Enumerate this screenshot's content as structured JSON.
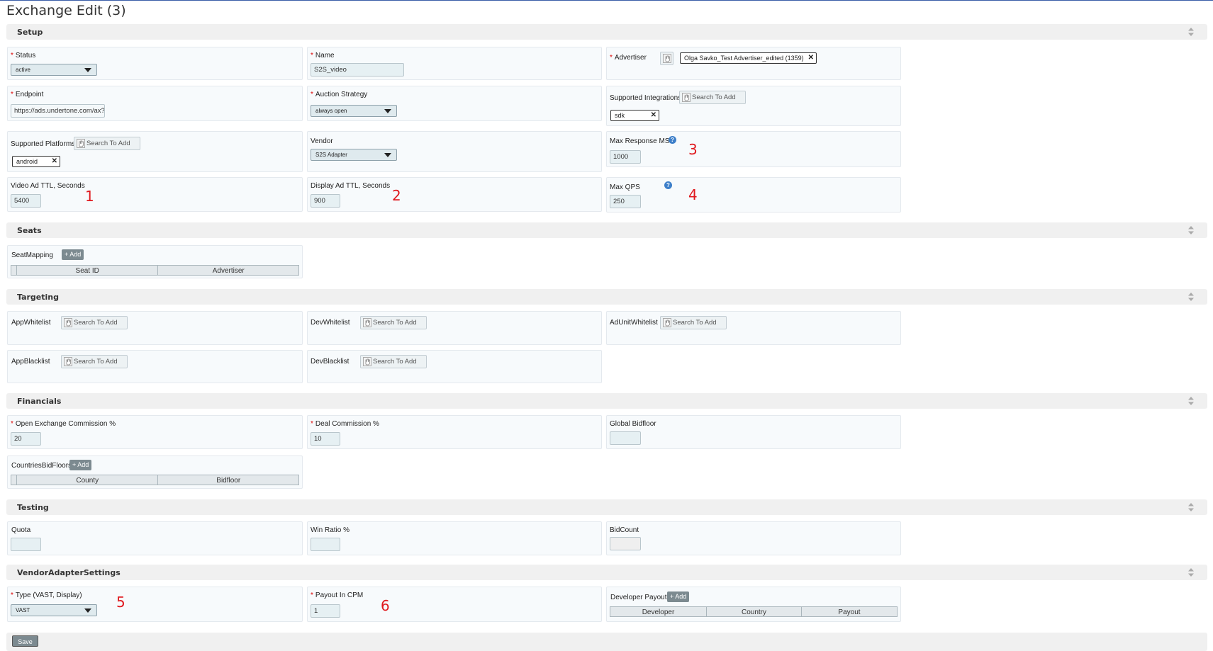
{
  "page": {
    "title": "Exchange Edit (3)"
  },
  "sections": {
    "setup": "Setup",
    "seats": "Seats",
    "targeting": "Targeting",
    "financials": "Financials",
    "testing": "Testing",
    "vendor": "VendorAdapterSettings"
  },
  "setup": {
    "status": {
      "label": "Status",
      "value": "active"
    },
    "name": {
      "label": "Name",
      "value": "S2S_video"
    },
    "advertiser": {
      "label": "Advertiser",
      "tag": "Olga Savko_Test Advertiser_edited (1359)"
    },
    "endpoint": {
      "label": "Endpoint",
      "value": "https://ads.undertone.com/ax?zo"
    },
    "auction_strategy": {
      "label": "Auction Strategy",
      "value": "always open"
    },
    "supported_integrations": {
      "label": "Supported Integrations",
      "placeholder": "Search To Add",
      "tag": "sdk"
    },
    "supported_platforms": {
      "label": "Supported Platforms",
      "placeholder": "Search To Add",
      "tag": "android"
    },
    "vendor": {
      "label": "Vendor",
      "value": "S2S Adapter"
    },
    "max_response": {
      "label": "Max Response MS",
      "value": "1000",
      "help": "?"
    },
    "video_ttl": {
      "label": "Video Ad TTL, Seconds",
      "value": "5400"
    },
    "display_ttl": {
      "label": "Display Ad TTL, Seconds",
      "value": "900"
    },
    "max_qps": {
      "label": "Max QPS",
      "value": "250",
      "help": "?"
    }
  },
  "annotations": [
    "1",
    "2",
    "3",
    "4",
    "5",
    "6"
  ],
  "seats": {
    "label": "SeatMapping",
    "add": "+ Add",
    "columns": [
      "Seat ID",
      "Advertiser"
    ]
  },
  "targeting": {
    "app_whitelist": "AppWhitelist",
    "dev_whitelist": "DevWhitelist",
    "adunit_whitelist": "AdUnitWhitelist",
    "app_blacklist": "AppBlacklist",
    "dev_blacklist": "DevBlacklist",
    "placeholder": "Search To Add"
  },
  "financials": {
    "open_commission": {
      "label": "Open Exchange Commission %",
      "value": "20"
    },
    "deal_commission": {
      "label": "Deal Commission %",
      "value": "10"
    },
    "global_bidfloor": {
      "label": "Global Bidfloor",
      "value": ""
    },
    "countries": {
      "label": "CountriesBidFloors",
      "add": "+ Add",
      "columns": [
        "County",
        "Bidfloor"
      ]
    }
  },
  "testing": {
    "quota": {
      "label": "Quota",
      "value": ""
    },
    "win_ratio": {
      "label": "Win Ratio %",
      "value": ""
    },
    "bid_count": {
      "label": "BidCount",
      "value": ""
    }
  },
  "vendor_settings": {
    "type": {
      "label": "Type (VAST, Display)",
      "value": "VAST"
    },
    "payout": {
      "label": "Payout In CPM",
      "value": "1"
    },
    "dev_payouts": {
      "label": "Developer Payouts",
      "add": "+ Add",
      "columns": [
        "Developer",
        "Country",
        "Payout"
      ]
    }
  },
  "save": "Save"
}
